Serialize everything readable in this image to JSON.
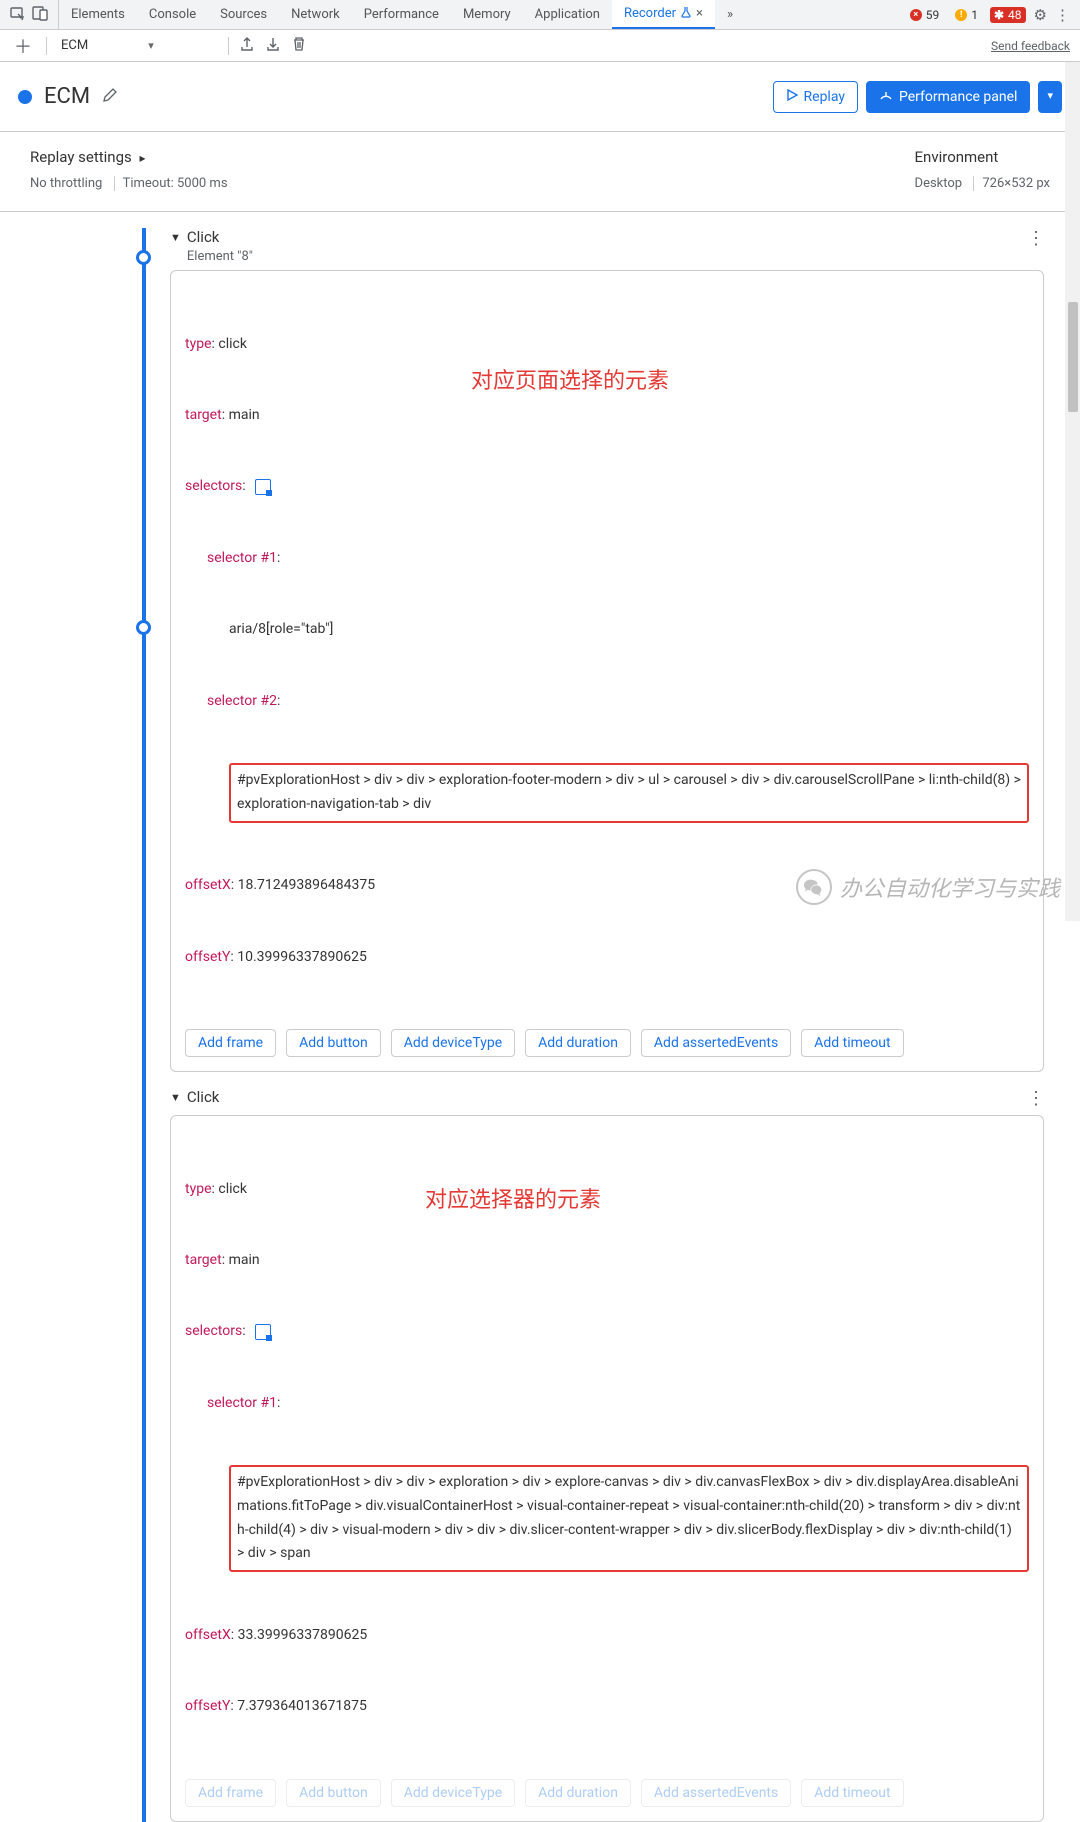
{
  "tabbar": {
    "tabs": [
      "Elements",
      "Console",
      "Sources",
      "Network",
      "Performance",
      "Memory",
      "Application",
      "Recorder"
    ],
    "active": "Recorder",
    "more": "»",
    "errors": "59",
    "warnings": "1",
    "ext": "48"
  },
  "toolbar": {
    "selected": "ECM",
    "feedback": "Send feedback"
  },
  "header": {
    "name": "ECM",
    "replay": "Replay",
    "perf_panel": "Performance panel"
  },
  "settings": {
    "left_title": "Replay settings",
    "throttling": "No throttling",
    "timeout": "Timeout: 5000 ms",
    "right_title": "Environment",
    "device": "Desktop",
    "dims": "726×532 px"
  },
  "steps": [
    {
      "title": "Click",
      "subtitle": "Element \"8\"",
      "type_k": "type",
      "type_v": "click",
      "target_k": "target",
      "target_v": "main",
      "selectors_k": "selectors",
      "sel1_label": "selector #1",
      "sel1_val": "aria/8[role=\"tab\"]",
      "sel2_label": "selector #2",
      "sel2_val": "#pvExplorationHost > div > div > exploration-footer-modern > div > ul > carousel > div > div.carouselScrollPane > li:nth-child(8) > exploration-navigation-tab > div",
      "offx_k": "offsetX",
      "offx_v": "18.712493896484375",
      "offy_k": "offsetY",
      "offy_v": "10.39996337890625",
      "annotation": "对应页面选择的元素"
    },
    {
      "title": "Click",
      "subtitle": "",
      "type_k": "type",
      "type_v": "click",
      "target_k": "target",
      "target_v": "main",
      "selectors_k": "selectors",
      "sel1_label": "selector #1",
      "sel1_val": "#pvExplorationHost > div > div > exploration > div > explore-canvas > div > div.canvasFlexBox > div > div.displayArea.disableAnimations.fitToPage > div.visualContainerHost > visual-container-repeat > visual-container:nth-child(20) > transform > div > div:nth-child(4) > div > visual-modern > div > div > div.slicer-content-wrapper > div > div.slicerBody.flexDisplay > div > div:nth-child(1) > div > span",
      "offx_k": "offsetX",
      "offx_v": "33.39996337890625",
      "offy_k": "offsetY",
      "offy_v": "7.379364013671875",
      "annotation": "对应选择器的元素"
    }
  ],
  "add_buttons": [
    "Add frame",
    "Add button",
    "Add deviceType",
    "Add duration",
    "Add assertedEvents",
    "Add timeout"
  ],
  "watermark": "办公自动化学习与实践"
}
